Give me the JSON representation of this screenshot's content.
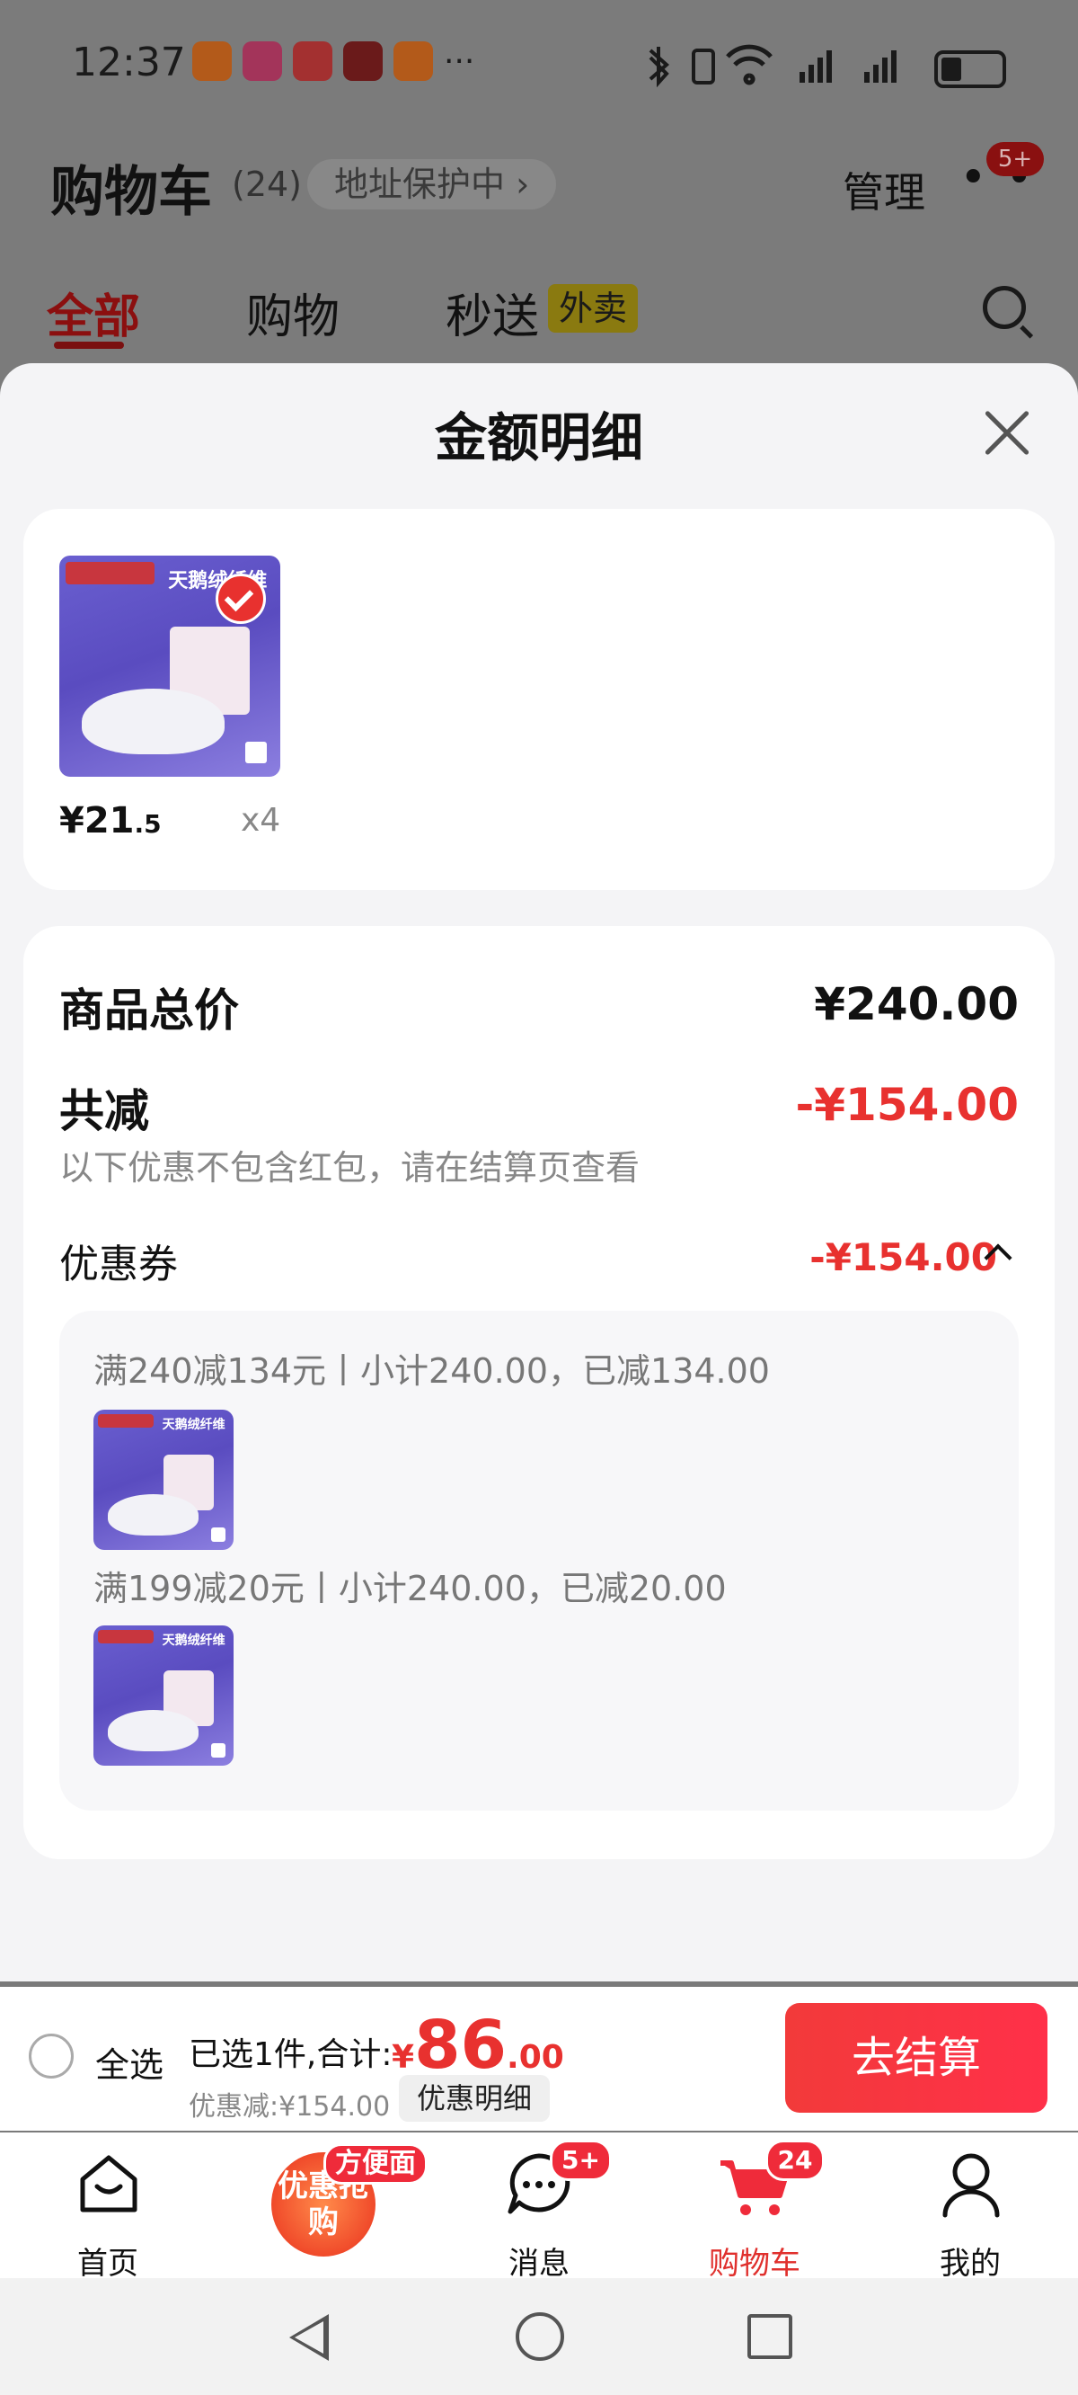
{
  "status_bar": {
    "time": "12:37",
    "more": "···"
  },
  "header": {
    "title": "购物车",
    "count": "(24)",
    "address_pill": "地址保护中 ›",
    "manage": "管理",
    "more_badge": "5+"
  },
  "tabs": [
    {
      "label": "全部"
    },
    {
      "label": "购物"
    },
    {
      "label": "秒送"
    }
  ],
  "tab_tag": "外卖",
  "sheet": {
    "title": "金额明细",
    "item": {
      "banner_text": "天鹅绒纤维",
      "price_main": "¥21",
      "price_decimal": ".5",
      "quantity": "x4"
    },
    "summary": {
      "goods_total_label": "商品总价",
      "goods_total_value": "¥240.00",
      "discount_label": "共减",
      "discount_value": "-¥154.00",
      "discount_note": "以下优惠不包含红包，请在结算页查看",
      "coupon_label": "优惠券",
      "coupon_value": "-¥154.00"
    },
    "coupon_rules": [
      {
        "text": "满240减134元丨小计240.00，已减134.00"
      },
      {
        "text": "满199减20元丨小计240.00，已减20.00"
      }
    ]
  },
  "checkout": {
    "select_all": "全选",
    "selected_text": "已选1件,合计:",
    "currency": "¥",
    "total_int": "86",
    "total_dec": ".00",
    "discount_text": "优惠减:¥154.00",
    "detail_button": "优惠明细",
    "checkout_button": "去结算"
  },
  "tabbar": {
    "items": [
      {
        "label": "首页"
      },
      {
        "label": "优惠抢购",
        "badge": "方便面"
      },
      {
        "label": "消息",
        "badge": "5+"
      },
      {
        "label": "购物车",
        "badge": "24"
      },
      {
        "label": "我的"
      }
    ]
  },
  "colors": {
    "accent": "#e8312f",
    "checkout_button": "#f23a3a",
    "tab_active": "#e0302d"
  },
  "icons": [
    "bluetooth-icon",
    "vibrate-icon",
    "wifi-icon",
    "signal-icon",
    "battery-icon",
    "close-icon",
    "search-icon",
    "home-icon",
    "chat-icon",
    "cart-icon",
    "profile-icon",
    "nav-back-icon",
    "nav-home-icon",
    "nav-recent-icon"
  ]
}
